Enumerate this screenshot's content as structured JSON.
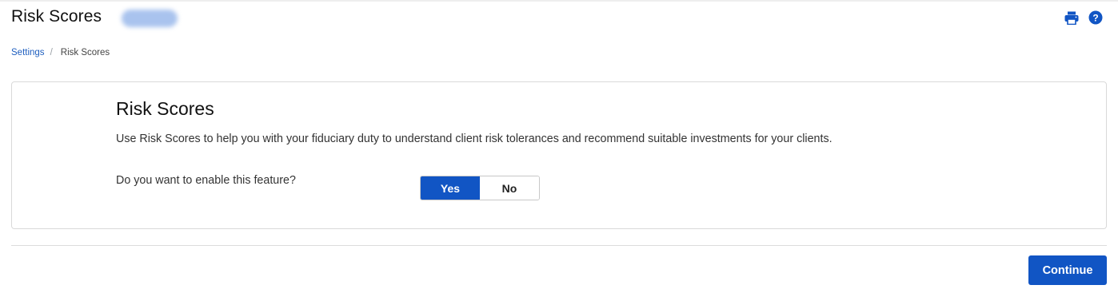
{
  "header": {
    "title": "Risk Scores"
  },
  "icons": {
    "print": "print-icon",
    "help": "help-icon"
  },
  "breadcrumb": {
    "parent": "Settings",
    "separator": "/",
    "current": "Risk Scores"
  },
  "card": {
    "title": "Risk Scores",
    "description": "Use Risk Scores to help you with your fiduciary duty to understand client risk tolerances and recommend suitable investments for your clients.",
    "question": "Do you want to enable this feature?",
    "options": {
      "yes": "Yes",
      "no": "No",
      "selected": "Yes"
    }
  },
  "footer": {
    "continue_label": "Continue"
  },
  "colors": {
    "accent": "#1155c4",
    "link": "#1f5fbf"
  }
}
